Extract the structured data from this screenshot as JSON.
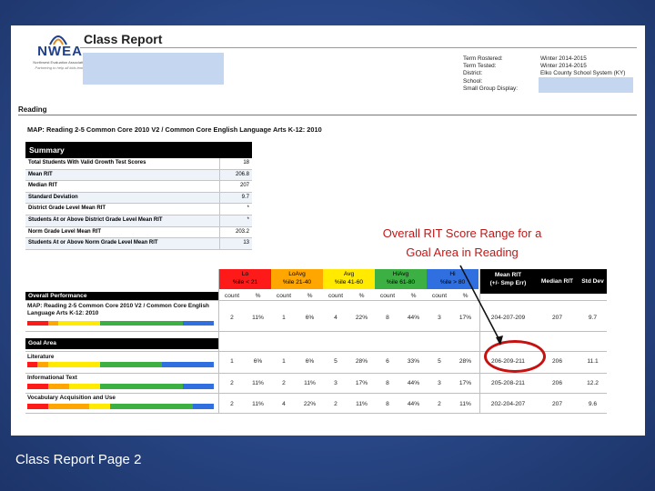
{
  "logo": {
    "name": "NWEA",
    "subtitle_1": "Northwest Evaluation Association",
    "subtitle_2": "Partnering to help all kids learn"
  },
  "report_title": "Class Report",
  "meta": [
    {
      "label": "Term Rostered:",
      "value": "Winter 2014-2015"
    },
    {
      "label": "Term Tested:",
      "value": "Winter 2014-2015"
    },
    {
      "label": "District:",
      "value": "Elko County School System (KY)"
    },
    {
      "label": "School:",
      "value": ""
    },
    {
      "label": "Small Group Display:",
      "value": "No"
    }
  ],
  "section_title": "Reading",
  "map_title": "MAP: Reading 2-5 Common Core 2010 V2 / Common Core English Language Arts K-12: 2010",
  "summary": {
    "header": "Summary",
    "rows": [
      {
        "label": "Total Students With Valid Growth Test Scores",
        "value": "18"
      },
      {
        "label": "Mean RIT",
        "value": "206.8"
      },
      {
        "label": "Median RIT",
        "value": "207"
      },
      {
        "label": "Standard Deviation",
        "value": "9.7"
      },
      {
        "label": "District Grade Level Mean RIT",
        "value": "*"
      },
      {
        "label": "Students At or Above District Grade Level Mean RIT",
        "value": "*"
      },
      {
        "label": "Norm Grade Level Mean RIT",
        "value": "203.2"
      },
      {
        "label": "Students At or Above Norm Grade Level Mean RIT",
        "value": "13"
      }
    ]
  },
  "annotation": {
    "line1": "Overall RIT Score Range for a",
    "line2": "Goal Area in Reading"
  },
  "bands": [
    {
      "name": "Lo",
      "range": "%ile < 21",
      "color": "#ff1a1a"
    },
    {
      "name": "LoAvg",
      "range": "%ile 21-40",
      "color": "#ffa600"
    },
    {
      "name": "Avg",
      "range": "%ile 41-60",
      "color": "#ffea00"
    },
    {
      "name": "HiAvg",
      "range": "%ile 61-80",
      "color": "#3cb043"
    },
    {
      "name": "Hi",
      "range": "%ile > 80",
      "color": "#2f6fe0"
    }
  ],
  "columns": {
    "count": "count",
    "pct": "%",
    "mean_rit": "Mean RIT",
    "mean_rit_sub": "(+/- Smp Err)",
    "median_rit": "Median RIT",
    "std_dev": "Std Dev"
  },
  "overall_performance": "Overall Performance",
  "overall_row": {
    "label": "MAP: Reading 2-5 Common Core 2010 V2 / Common Core English Language Arts K-12: 2010",
    "counts": [
      "2",
      "1",
      "4",
      "8",
      "3"
    ],
    "pcts": [
      "11%",
      "6%",
      "22%",
      "44%",
      "17%"
    ],
    "mean_rit": "204-207-209",
    "median_rit": "207",
    "std_dev": "9.7"
  },
  "goal_area_header": "Goal Area",
  "goal_rows": [
    {
      "label": "Literature",
      "counts": [
        "1",
        "1",
        "5",
        "6",
        "5"
      ],
      "pcts": [
        "6%",
        "6%",
        "28%",
        "33%",
        "28%"
      ],
      "mean_rit": "206-209-211",
      "median_rit": "206",
      "std_dev": "11.1"
    },
    {
      "label": "Informational Text",
      "counts": [
        "2",
        "2",
        "3",
        "8",
        "3"
      ],
      "pcts": [
        "11%",
        "11%",
        "17%",
        "44%",
        "17%"
      ],
      "mean_rit": "205-208-211",
      "median_rit": "206",
      "std_dev": "12.2"
    },
    {
      "label": "Vocabulary Acquisition and Use",
      "counts": [
        "2",
        "4",
        "2",
        "8",
        "2"
      ],
      "pcts": [
        "11%",
        "22%",
        "11%",
        "44%",
        "11%"
      ],
      "mean_rit": "202-204-207",
      "median_rit": "207",
      "std_dev": "9.6"
    }
  ],
  "footer": "Class Report Page 2"
}
